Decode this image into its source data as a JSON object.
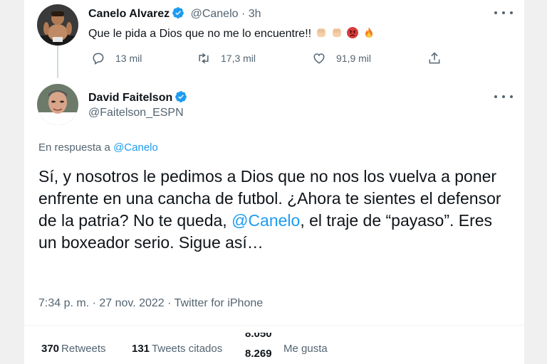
{
  "first_tweet": {
    "author_name": "Canelo Alvarez",
    "handle": "@Canelo",
    "separator": "·",
    "time": "3h",
    "text": "Que le pida a Dios que no me lo encuentre!! ",
    "emojis": [
      "fist",
      "fist",
      "angry-face",
      "fire"
    ],
    "actions": {
      "replies": "13 mil",
      "retweets": "17,3 mil",
      "likes": "91,9 mil"
    }
  },
  "second_tweet": {
    "author_name": "David Faitelson",
    "handle": "@Faitelson_ESPN",
    "reply_prefix": "En respuesta a",
    "reply_handle": "@Canelo",
    "text_part1": "Sí, y nosotros le pedimos a Dios que no nos los vuelva a poner enfrente en una cancha de futbol. ¿Ahora te sientes el defensor de la patria? No te queda, ",
    "text_mention": "@Canelo",
    "text_part2": ", el traje de “payaso”. Eres un boxeador serio. Sigue así…",
    "timestamp": "7:34 p. m. · 27 nov. 2022 · Twitter for iPhone"
  },
  "stats": {
    "retweets_count": "370",
    "retweets_label": "Retweets",
    "quotes_count": "131",
    "quotes_label": "Tweets citados",
    "likes_count_top": "8.050",
    "likes_count_bottom": "8.269",
    "likes_label": "Me gusta"
  },
  "colors": {
    "accent": "#1d9bf0",
    "secondary_text": "#536471",
    "primary_text": "#0f1419"
  }
}
